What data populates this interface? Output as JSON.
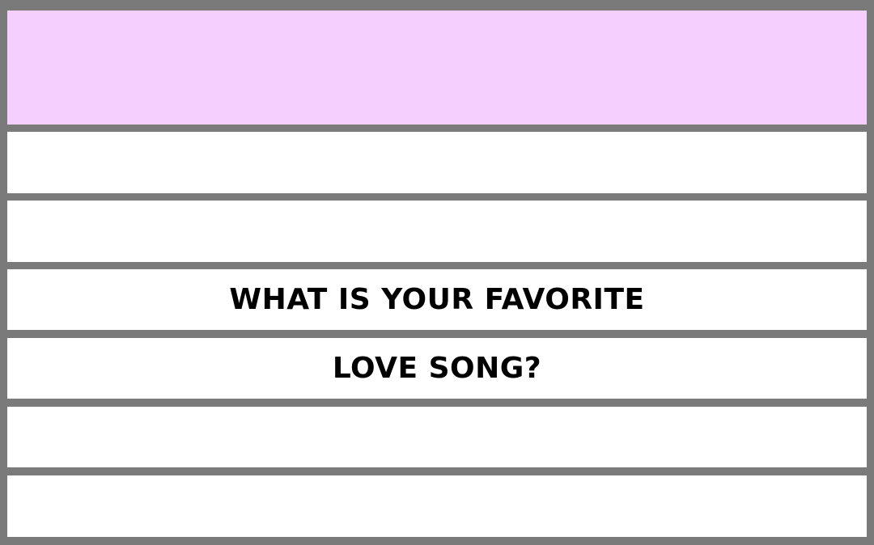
{
  "question": {
    "line_1": "WHAT IS YOUR FAVORITE",
    "line_2": "LOVE SONG?"
  },
  "colors": {
    "header_fill": "#f5d0fe",
    "frame": "#7a7a7a",
    "row_fill": "#ffffff",
    "text": "#000000"
  }
}
